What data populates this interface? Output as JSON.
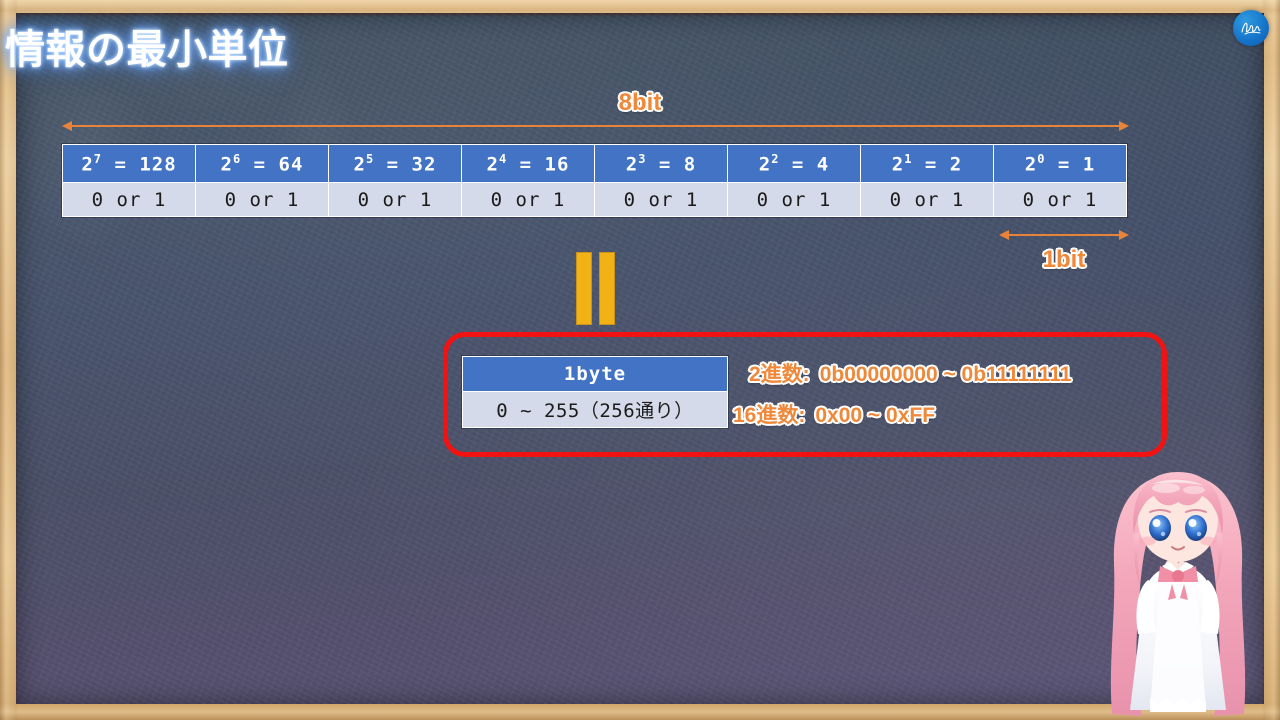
{
  "slide": {
    "title": "情報の最小単位",
    "logo_icon": "signature-logo-icon"
  },
  "top_measure": {
    "label": "8bit",
    "arrow_icon": "double-headed-arrow-icon"
  },
  "bit_measure": {
    "label": "1bit",
    "arrow_icon": "double-headed-arrow-icon"
  },
  "bit_table": {
    "headers": [
      "2⁷ = 128",
      "2⁶ = 64",
      "2⁵ = 32",
      "2⁴ = 16",
      "2³ = 8",
      "2² = 4",
      "2¹ = 2",
      "2⁰ = 1"
    ],
    "header_parts": [
      {
        "base": "2",
        "exp": "7",
        "rest": " = 128"
      },
      {
        "base": "2",
        "exp": "6",
        "rest": " = 64"
      },
      {
        "base": "2",
        "exp": "5",
        "rest": " = 32"
      },
      {
        "base": "2",
        "exp": "4",
        "rest": " = 16"
      },
      {
        "base": "2",
        "exp": "3",
        "rest": " = 8"
      },
      {
        "base": "2",
        "exp": "2",
        "rest": " = 4"
      },
      {
        "base": "2",
        "exp": "1",
        "rest": " = 2"
      },
      {
        "base": "2",
        "exp": "0",
        "rest": " = 1"
      }
    ],
    "values": [
      "0 or 1",
      "0 or 1",
      "0 or 1",
      "0 or 1",
      "0 or 1",
      "0 or 1",
      "0 or 1",
      "0 or 1"
    ]
  },
  "equals_symbol": {
    "icon": "equals-sign-icon",
    "color": "#F2B215"
  },
  "byte_box": {
    "border_color": "#F21212",
    "header": "1byte",
    "value": "0 ~ 255（256通り）",
    "notations": [
      {
        "label": "2進数:",
        "value": "0b00000000 ~ 0b11111111"
      },
      {
        "label": "16進数:",
        "value": "0x00 ~ 0xFF"
      }
    ]
  },
  "character": {
    "name": "anime-mascot-character",
    "hair_color": "#F2A8B8",
    "eye_color": "#2F6FD0",
    "dress_color": "#FFFFFF",
    "bow_color": "#F28BA0"
  },
  "theme": {
    "board_color": "#47506A",
    "frame_color": "#E0BA83",
    "header_blue": "#4273C4",
    "cell_lavender": "#D4DAE9",
    "accent_orange": "#F0883A",
    "accent_red": "#F21212",
    "accent_yellow": "#F2B215"
  }
}
